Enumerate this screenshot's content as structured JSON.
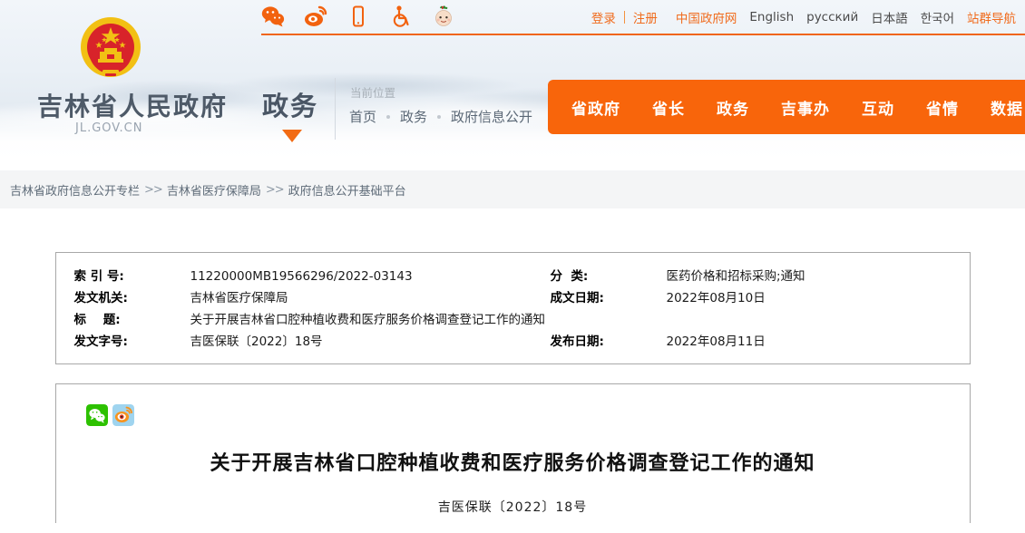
{
  "header": {
    "site_title": "吉林省人民政府",
    "site_domain": "JL.GOV.CN",
    "section_label": "政务",
    "emblem_alt": "国徽",
    "social_icons": [
      {
        "name": "wechat-icon",
        "label": "微信"
      },
      {
        "name": "weibo-icon",
        "label": "微博"
      },
      {
        "name": "mobile-icon",
        "label": "手机版"
      },
      {
        "name": "accessibility-icon",
        "label": "无障碍"
      },
      {
        "name": "elderly-child-mode-icon",
        "label": "长辈版"
      }
    ],
    "auth": {
      "login": "登录",
      "register": "注册"
    },
    "languages": [
      {
        "label": "中国政府网",
        "style": "cn"
      },
      {
        "label": "English",
        "style": "en"
      },
      {
        "label": "русский",
        "style": "en"
      },
      {
        "label": "日本語",
        "style": "en"
      },
      {
        "label": "한국어",
        "style": "en"
      },
      {
        "label": "站群导航",
        "style": "nav"
      }
    ],
    "current_position": {
      "label": "当前位置",
      "crumbs": [
        "首页",
        "政务",
        "政府信息公开"
      ]
    },
    "main_nav": [
      "省政府",
      "省长",
      "政务",
      "吉事办",
      "互动",
      "省情",
      "数据"
    ]
  },
  "subbar": {
    "crumbs": [
      "吉林省政府信息公开专栏",
      "吉林省医疗保障局",
      "政府信息公开基础平台"
    ],
    "separator": ">>"
  },
  "meta": {
    "left": [
      {
        "key": "索 引 号:",
        "value": "11220000MB19566296/2022-03143"
      },
      {
        "key": "发文机关:",
        "value": "吉林省医疗保障局"
      },
      {
        "key": "标    题:",
        "value": "关于开展吉林省口腔种植收费和医疗服务价格调查登记工作的通知"
      },
      {
        "key": "发文字号:",
        "value": "吉医保联〔2022〕18号"
      }
    ],
    "right": [
      {
        "key": "分  类:",
        "value": "医药价格和招标采购;通知"
      },
      {
        "key": "成文日期:",
        "value": "2022年08月10日"
      },
      {
        "key": "",
        "value": ""
      },
      {
        "key": "发布日期:",
        "value": "2022年08月11日"
      }
    ]
  },
  "document": {
    "share_icons": [
      {
        "name": "wechat-share-icon",
        "label": "分享到微信"
      },
      {
        "name": "weibo-share-icon",
        "label": "分享到微博"
      }
    ],
    "title": "关于开展吉林省口腔种植收费和医疗服务价格调查登记工作的通知",
    "number": "吉医保联〔2022〕18号"
  },
  "colors": {
    "brand_orange": "#f8650b",
    "link_orange": "#f06c1e",
    "header_bg": "#eaf0f6",
    "subbar_bg": "#f4f5f6",
    "border_grey": "#a8a8a8"
  }
}
